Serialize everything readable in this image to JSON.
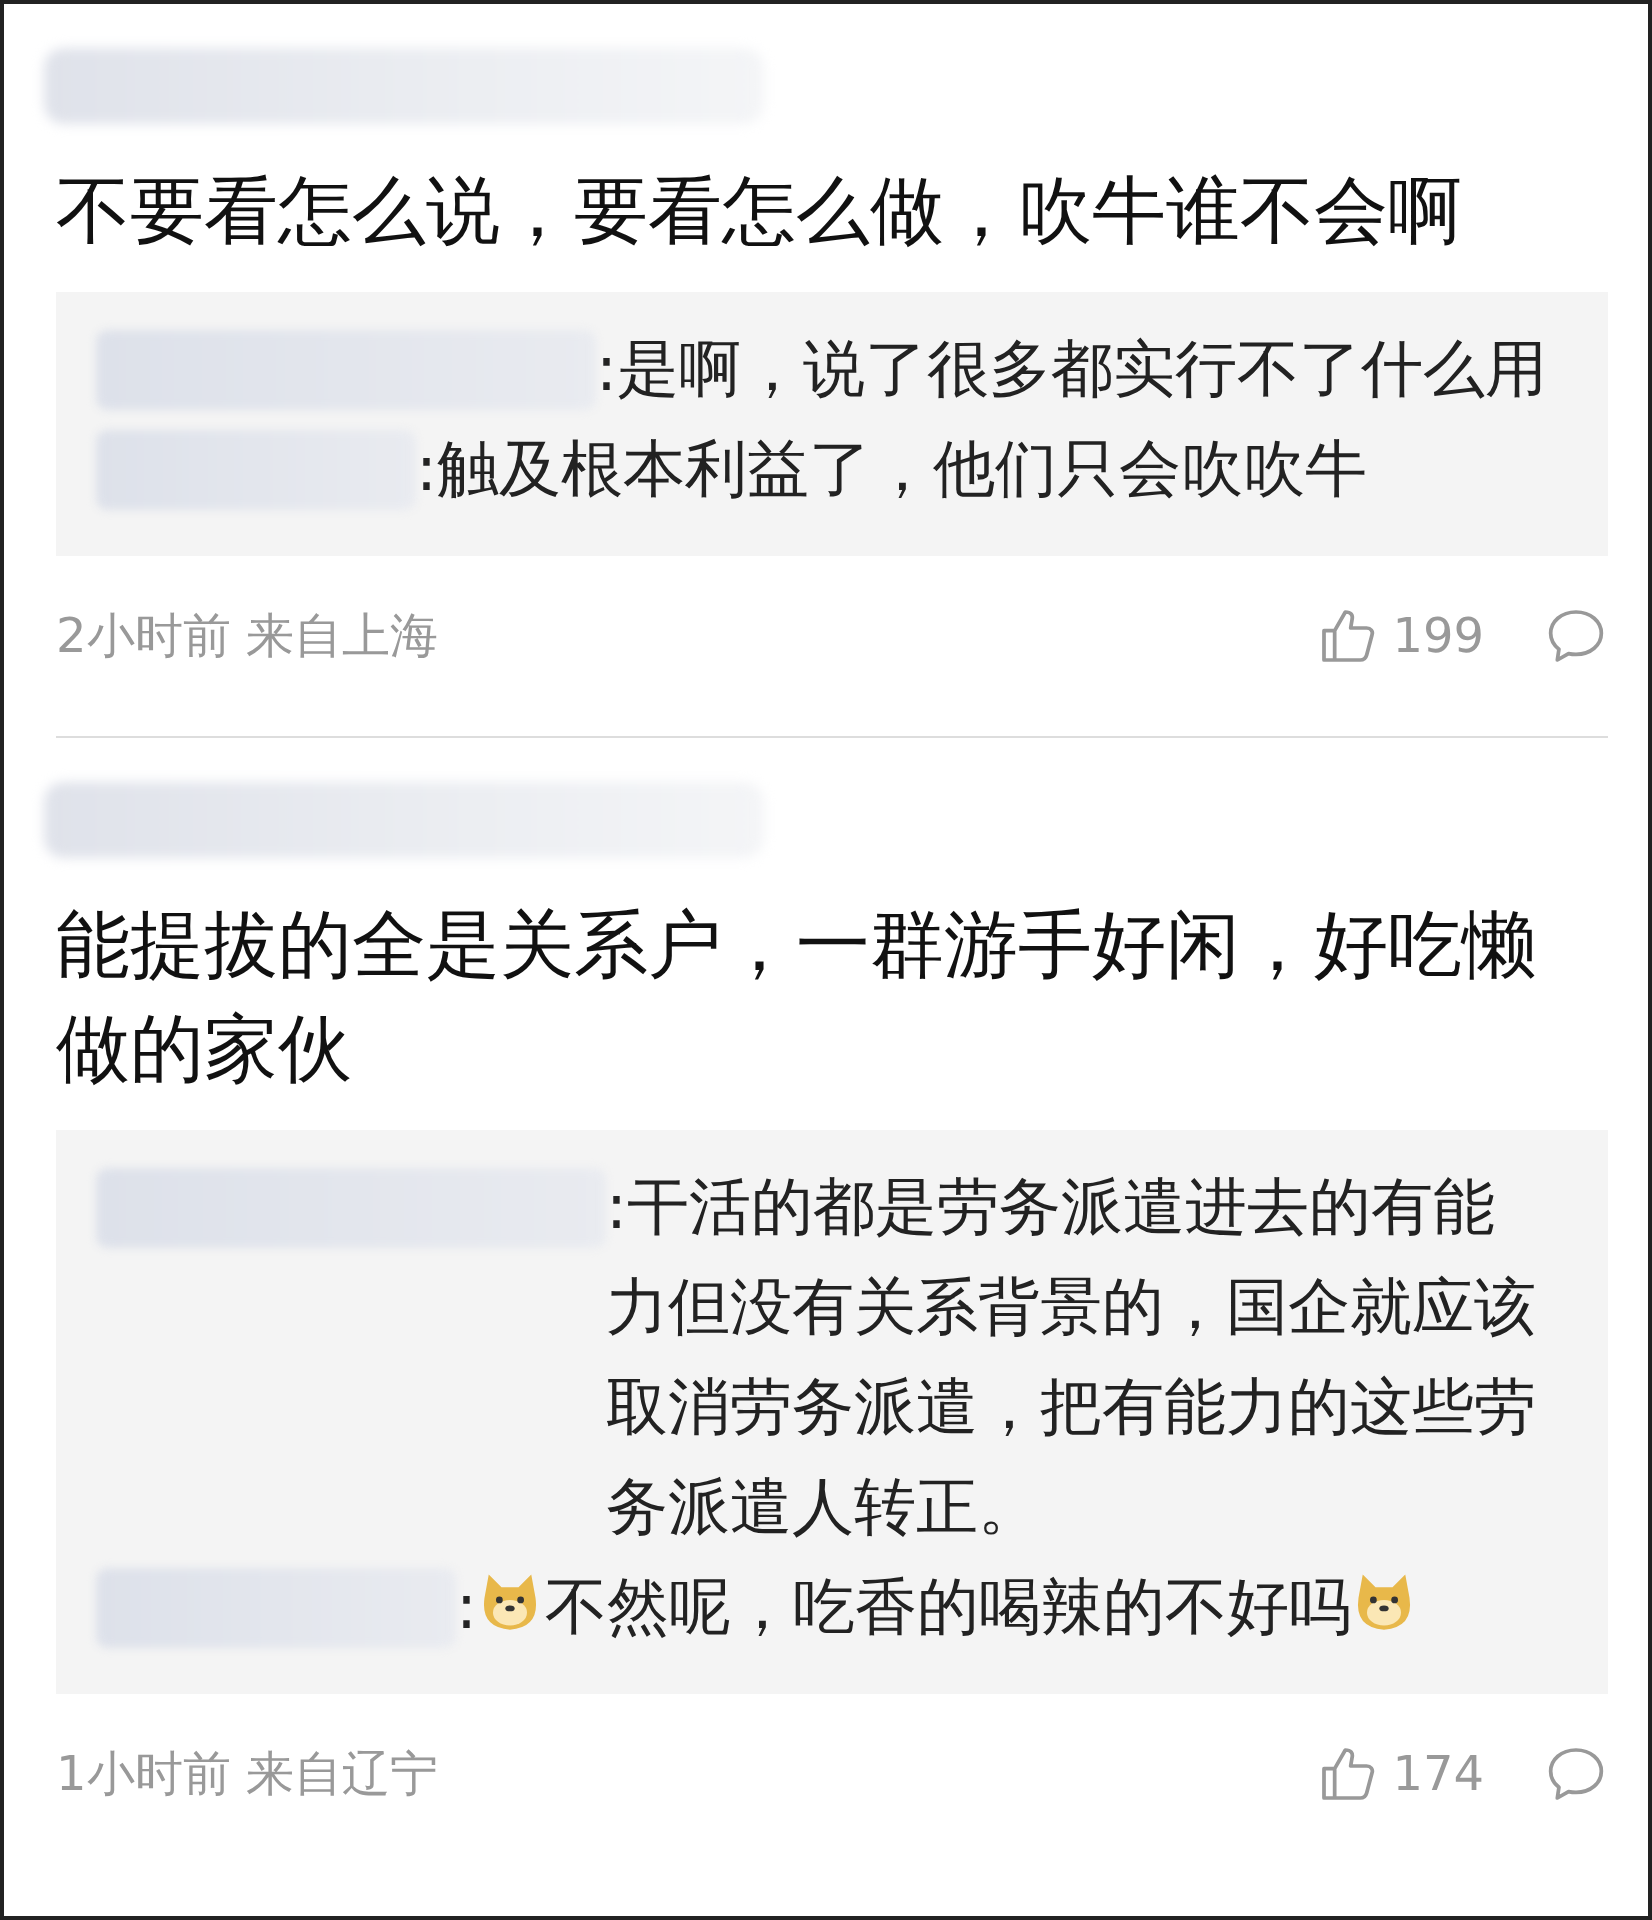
{
  "comments": [
    {
      "text": "不要看怎么说，要看怎么做，吹牛谁不会啊",
      "replies": [
        {
          "segments": [
            {
              "kind": "text",
              "text": ":是啊，说了很多都实行不了什么用"
            }
          ]
        },
        {
          "segments": [
            {
              "kind": "text",
              "text": ":触及根本利益了，他们只会吹吹牛"
            }
          ]
        }
      ],
      "meta": "2小时前 来自上海",
      "likes": "199"
    },
    {
      "text": "能提拔的全是关系户，一群游手好闲，好吃懒做的家伙",
      "replies": [
        {
          "segments": [
            {
              "kind": "text",
              "text": ":干活的都是劳务派遣进去的有能力但没有关系背景的，国企就应该取消劳务派遣，把有能力的这些劳务派遣人转正。"
            }
          ]
        },
        {
          "segments": [
            {
              "kind": "text",
              "text": ":"
            },
            {
              "kind": "doge"
            },
            {
              "kind": "text",
              "text": "不然呢，吃香的喝辣的不好吗"
            },
            {
              "kind": "doge"
            }
          ]
        }
      ],
      "meta": "1小时前 来自辽宁",
      "likes": "174"
    }
  ]
}
